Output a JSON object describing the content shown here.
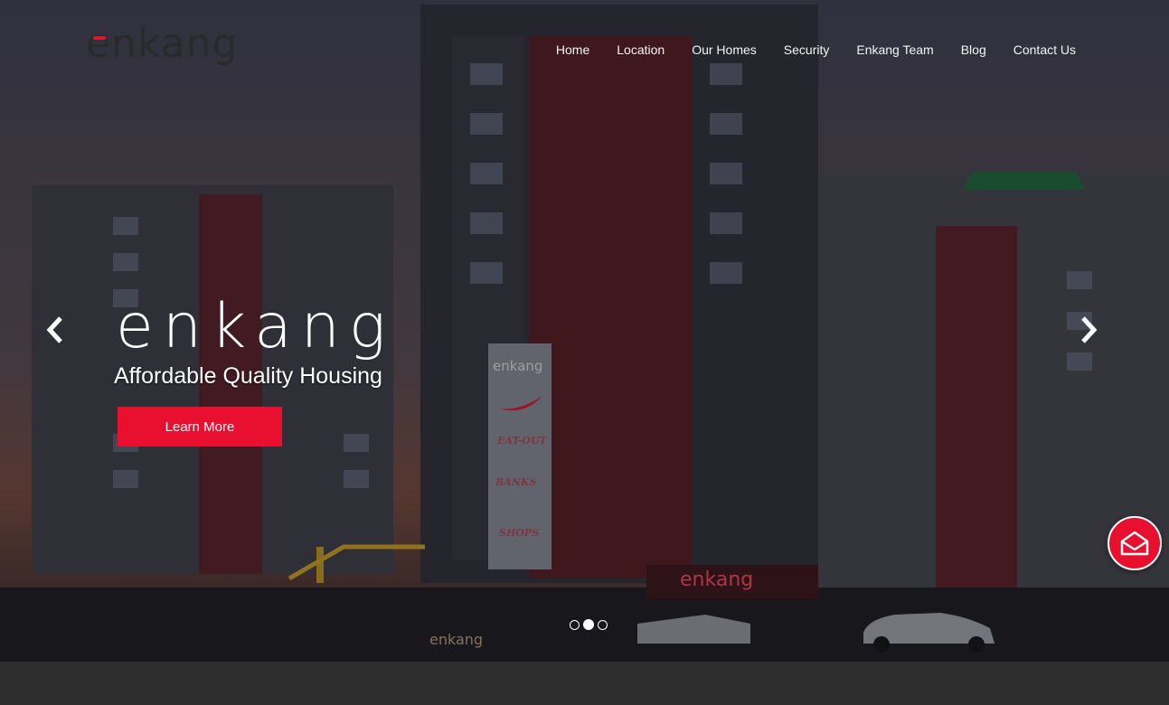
{
  "brand": {
    "logo_text": "enkang"
  },
  "nav": {
    "items": [
      {
        "label": "Home"
      },
      {
        "label": "Location"
      },
      {
        "label": "Our Homes"
      },
      {
        "label": "Security"
      },
      {
        "label": "Enkang Team"
      },
      {
        "label": "Blog"
      },
      {
        "label": "Contact Us"
      }
    ]
  },
  "carousel": {
    "title": "enkang",
    "tagline": "Affordable Quality Housing",
    "cta_label": "Learn More",
    "prev_icon": "chevron-left-icon",
    "next_icon": "chevron-right-icon",
    "slide_count": 3,
    "active_slide": 2
  },
  "building_signage": {
    "tower_sign": "enkang",
    "gate_sign": "enkang",
    "wall_sign": "enkang",
    "shop_labels": [
      "EAT-OUT",
      "BANKS",
      "SHOPS"
    ]
  },
  "contact_widget": {
    "icon": "envelope-icon"
  },
  "colors": {
    "accent": "#e8102e",
    "nav_text": "#f4f4f4",
    "footer_band": "#2e2e2e"
  }
}
